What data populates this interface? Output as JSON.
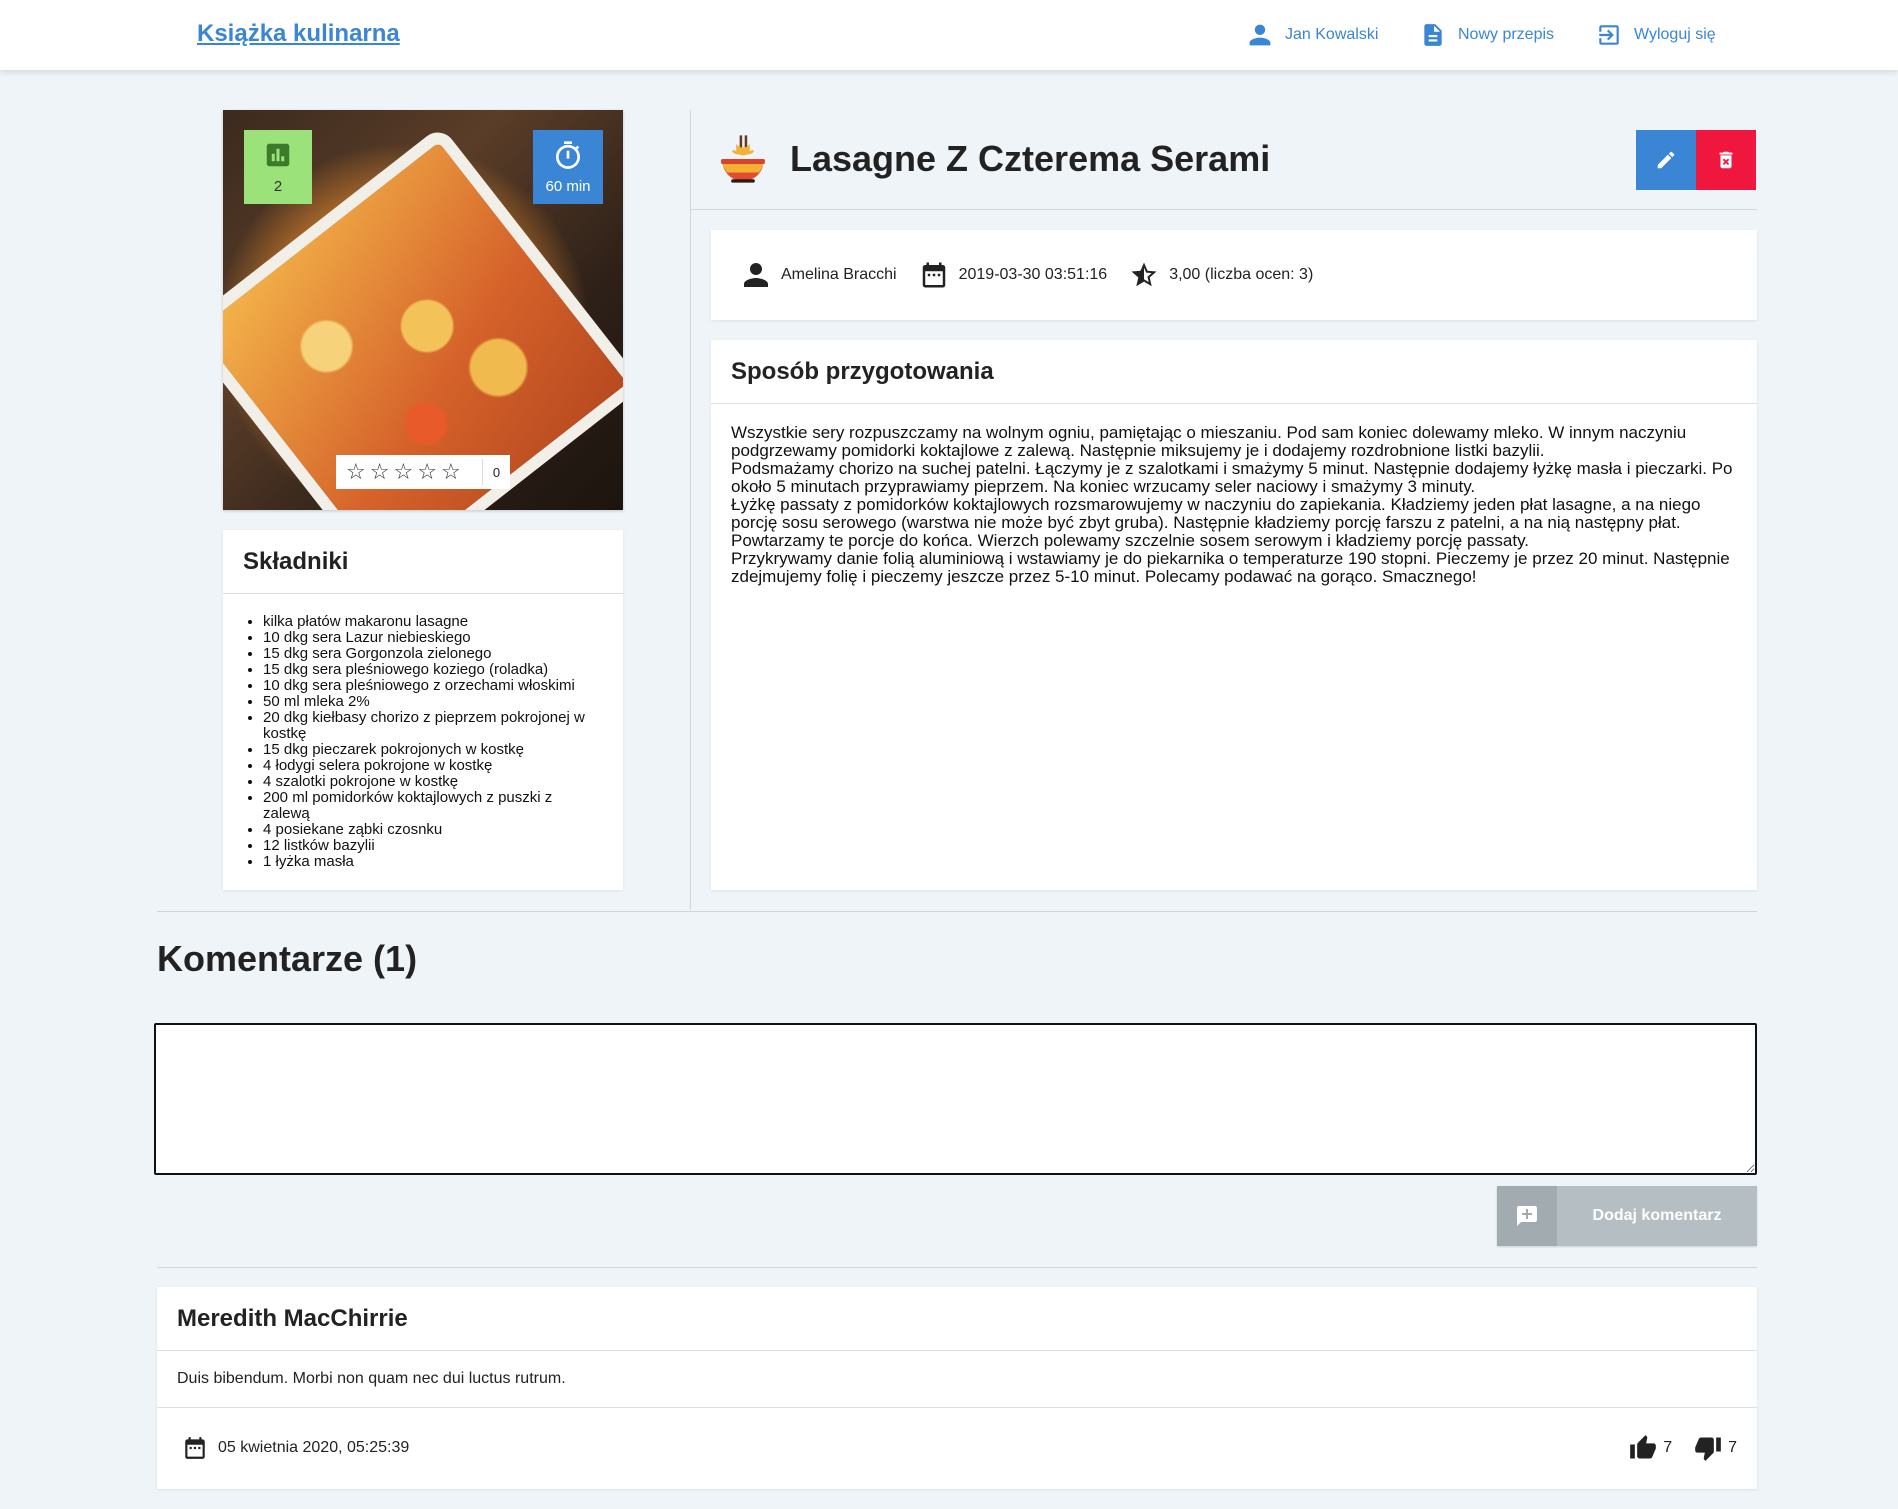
{
  "nav": {
    "brand": "Książka kulinarna",
    "user": "Jan Kowalski",
    "new_recipe": "Nowy przepis",
    "logout": "Wyloguj się"
  },
  "photo": {
    "level": "2",
    "time": "60 min",
    "rating_count": "0",
    "stars": 5,
    "level_color": "#9be27a",
    "time_color": "#3a86d4"
  },
  "ingredients": {
    "title": "Składniki",
    "items": [
      "kilka płatów makaronu lasagne",
      "10 dkg sera Lazur niebieskiego",
      "15 dkg sera Gorgonzola zielonego",
      "15 dkg sera pleśniowego koziego (roladka)",
      "10 dkg sera pleśniowego z orzechami włoskimi",
      "50 ml mleka 2%",
      "20 dkg kiełbasy chorizo z pieprzem pokrojonej w kostkę",
      "15 dkg pieczarek pokrojonych w kostkę",
      "4 łodygi selera pokrojone w kostkę",
      "4 szalotki pokrojone w kostkę",
      "200 ml pomidorków koktajlowych z puszki z zalewą",
      "4 posiekane ząbki czosnku",
      "12 listków bazylii",
      "1 łyżka masła"
    ]
  },
  "recipe": {
    "title": "Lasagne Z Czterema Serami",
    "author": "Amelina Bracchi",
    "date": "2019-03-30 03:51:16",
    "rating": "3,00 (liczba ocen: 3)",
    "edit_color": "#3a86d4",
    "delete_color": "#f0173f"
  },
  "preparation": {
    "title": "Sposób przygotowania",
    "paragraphs": [
      "Wszystkie sery rozpuszczamy na wolnym ogniu, pamiętając o mieszaniu. Pod sam koniec dolewamy mleko. W innym naczyniu podgrzewamy pomidorki koktajlowe z zalewą. Następnie miksujemy je i dodajemy rozdrobnione listki bazylii.",
      "Podsmażamy chorizo na suchej patelni. Łączymy je z szalotkami i smażymy 5 minut. Następnie dodajemy łyżkę masła i pieczarki. Po około 5 minutach przyprawiamy pieprzem. Na koniec wrzucamy seler naciowy i smażymy 3 minuty.",
      "Łyżkę passaty z pomidorków koktajlowych rozsmarowujemy w naczyniu do zapiekania. Kładziemy jeden płat lasagne, a na niego porcję sosu serowego (warstwa nie może być zbyt gruba). Następnie kładziemy porcję farszu z patelni, a na nią następny płat. Powtarzamy te porcje do końca. Wierzch polewamy szczelnie sosem serowym i kładziemy porcję passaty.",
      "Przykrywamy danie folią aluminiową i wstawiamy je do piekarnika o temperaturze 190 stopni. Pieczemy je przez 20 minut. Następnie zdejmujemy folię i pieczemy jeszcze przez 5-10 minut. Polecamy podawać na gorąco. Smacznego!"
    ]
  },
  "comments": {
    "title": "Komentarze (1)",
    "input_value": "",
    "add_label": "Dodaj komentarz",
    "items": [
      {
        "author": "Meredith MacChirrie",
        "text": "Duis bibendum. Morbi non quam nec dui luctus rutrum.",
        "date": "05 kwietnia 2020, 05:25:39",
        "likes": "7",
        "dislikes": "7"
      }
    ]
  }
}
